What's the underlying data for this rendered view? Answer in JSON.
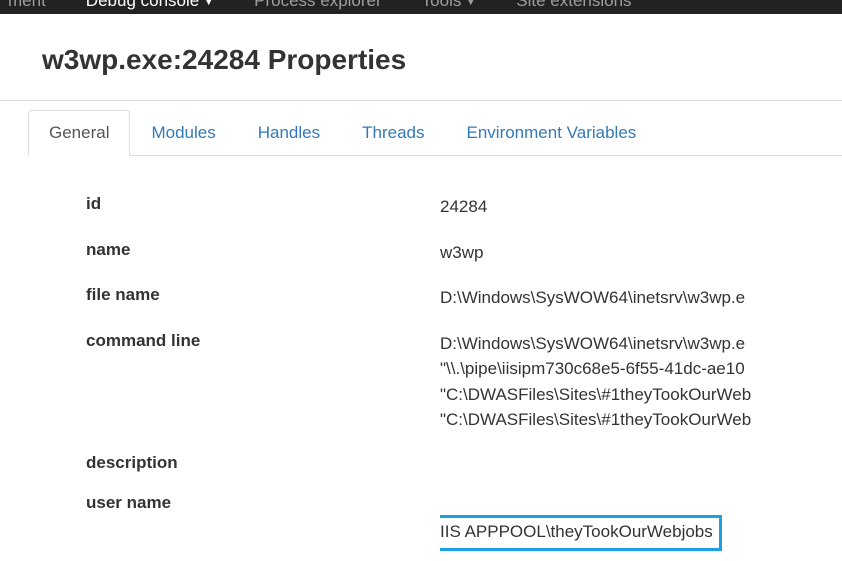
{
  "topbar": {
    "items": [
      {
        "label": "ment",
        "active": false,
        "has_caret": false
      },
      {
        "label": "Debug console",
        "active": true,
        "has_caret": true
      },
      {
        "label": "Process explorer",
        "active": false,
        "has_caret": false
      },
      {
        "label": "Tools",
        "active": false,
        "has_caret": true
      },
      {
        "label": "Site extensions",
        "active": false,
        "has_caret": false
      }
    ]
  },
  "page": {
    "title": "w3wp.exe:24284 Properties"
  },
  "tabs": [
    {
      "label": "General",
      "active": true
    },
    {
      "label": "Modules",
      "active": false
    },
    {
      "label": "Handles",
      "active": false
    },
    {
      "label": "Threads",
      "active": false
    },
    {
      "label": "Environment Variables",
      "active": false
    }
  ],
  "props": {
    "id": {
      "label": "id",
      "value": "24284"
    },
    "name": {
      "label": "name",
      "value": "w3wp"
    },
    "file_name": {
      "label": "file name",
      "value": "D:\\Windows\\SysWOW64\\inetsrv\\w3wp.e"
    },
    "command_line": {
      "label": "command line",
      "value": "D:\\Windows\\SysWOW64\\inetsrv\\w3wp.e\n\"\\\\.\\pipe\\iisipm730c68e5-6f55-41dc-ae10\n\"C:\\DWASFiles\\Sites\\#1theyTookOurWeb\n\"C:\\DWASFiles\\Sites\\#1theyTookOurWeb"
    },
    "description": {
      "label": "description",
      "value": ""
    },
    "user_name": {
      "label": "user name",
      "value": "IIS APPPOOL\\theyTookOurWebjobs"
    }
  }
}
